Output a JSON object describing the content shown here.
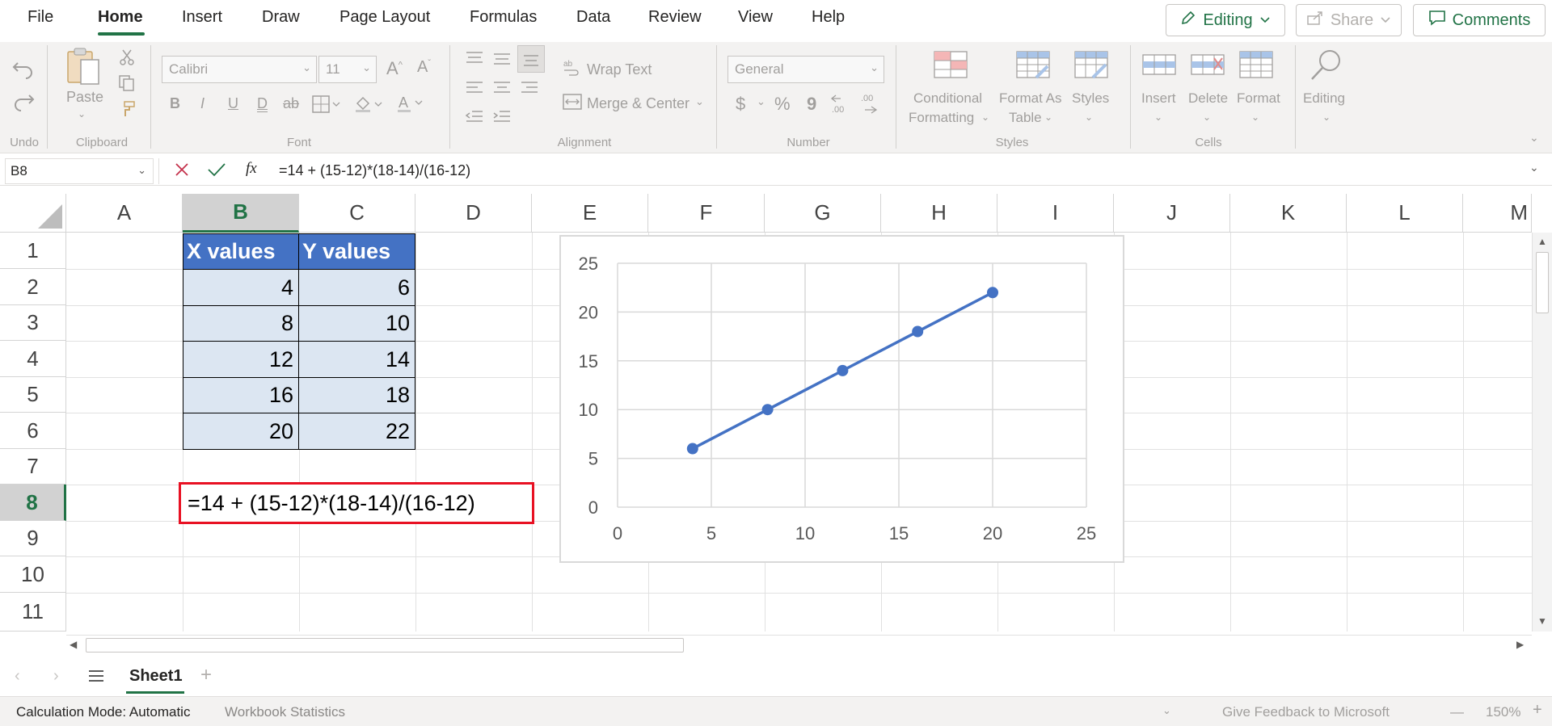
{
  "menu": {
    "tabs": [
      "File",
      "Home",
      "Insert",
      "Draw",
      "Page Layout",
      "Formulas",
      "Data",
      "Review",
      "View",
      "Help"
    ],
    "active": "Home",
    "editing_label": "Editing",
    "share_label": "Share",
    "comments_label": "Comments"
  },
  "ribbon": {
    "undo_label": "Undo",
    "clipboard": {
      "paste_label": "Paste",
      "group_label": "Clipboard"
    },
    "font": {
      "family": "Calibri",
      "size": "11",
      "group_label": "Font",
      "bold": "B",
      "italic": "I",
      "underline": "U",
      "double_underline": "D",
      "strike": "ab"
    },
    "alignment": {
      "wrap_text": "Wrap Text",
      "merge_center": "Merge & Center",
      "group_label": "Alignment"
    },
    "number": {
      "format": "General",
      "currency": "$",
      "percent": "%",
      "comma": "9",
      "group_label": "Number"
    },
    "styles": {
      "conditional_formatting": [
        "Conditional",
        "Formatting"
      ],
      "format_as_table": [
        "Format As",
        "Table"
      ],
      "styles": "Styles",
      "group_label": "Styles"
    },
    "cells": {
      "insert": "Insert",
      "delete": "Delete",
      "format": "Format",
      "group_label": "Cells"
    },
    "editing": {
      "label": "Editing"
    }
  },
  "formula_bar": {
    "name_box": "B8",
    "fx": "fx",
    "formula": "=14 + (15-12)*(18-14)/(16-12)"
  },
  "grid": {
    "columns": [
      "A",
      "B",
      "C",
      "D",
      "E",
      "F",
      "G",
      "H",
      "I",
      "J",
      "K",
      "L",
      "M"
    ],
    "selected_column": "B",
    "rows": [
      "1",
      "2",
      "3",
      "4",
      "5",
      "6",
      "7",
      "8",
      "9",
      "10",
      "11"
    ],
    "selected_row": "8",
    "headers": {
      "b1": "X values",
      "c1": "Y values"
    },
    "x_values": [
      "4",
      "8",
      "12",
      "16",
      "20"
    ],
    "y_values": [
      "6",
      "10",
      "14",
      "18",
      "22"
    ],
    "b8_formula": "=14 + (15-12)*(18-14)/(16-12)"
  },
  "chart_data": {
    "type": "scatter",
    "title": "",
    "xlabel": "",
    "ylabel": "",
    "series": [
      {
        "x": [
          4,
          8,
          12,
          16,
          20
        ],
        "y": [
          6,
          10,
          14,
          18,
          22
        ]
      }
    ],
    "xlim": [
      0,
      25
    ],
    "ylim": [
      0,
      25
    ],
    "x_ticks": [
      "0",
      "5",
      "10",
      "15",
      "20",
      "25"
    ],
    "y_ticks": [
      "0",
      "5",
      "10",
      "15",
      "20",
      "25"
    ],
    "grid": true,
    "marker_color": "#4472c4",
    "line_color": "#4472c4",
    "lines_connected": true
  },
  "tabs": {
    "sheets": [
      "Sheet1"
    ],
    "active": "Sheet1"
  },
  "status": {
    "calc_mode": "Calculation Mode: Automatic",
    "workbook_stats": "Workbook Statistics",
    "feedback": "Give Feedback to Microsoft",
    "zoom": "150%"
  },
  "colors": {
    "accent": "#217346",
    "header_fill": "#4472c4",
    "data_fill": "#dce6f2",
    "selection_border": "#e81123"
  }
}
